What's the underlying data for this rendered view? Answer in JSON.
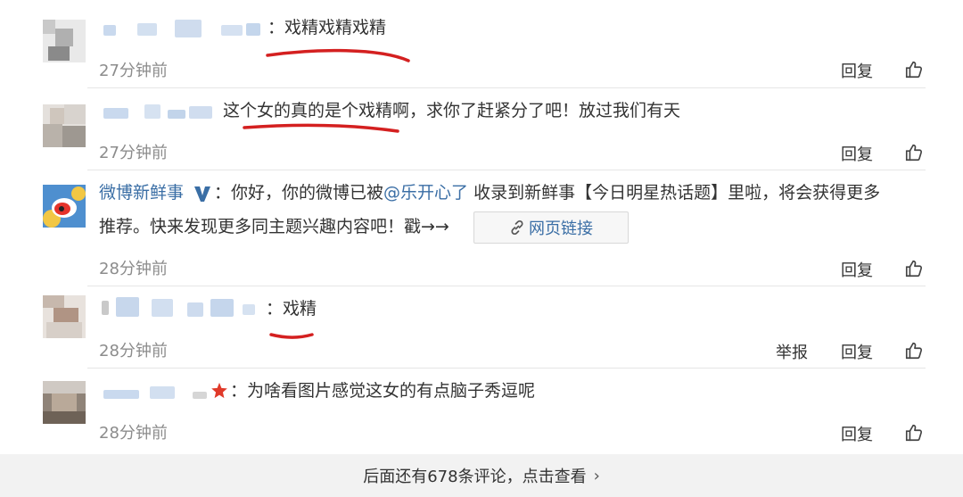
{
  "comments": [
    {
      "text": "戏精戏精戏精",
      "time": "27分钟前",
      "reply": "回复"
    },
    {
      "text": "这个女的真的是个戏精啊，求你了赶紧分了吧！放过我们有天",
      "time": "27分钟前",
      "reply": "回复"
    },
    {
      "user": "微博新鲜事",
      "text_line1_prefix": "：你好，你的微博已被",
      "mention": "@乐开心了",
      "text_line1_suffix": "收录到新鲜事【今日明星热话题】里啦，将会获得更多",
      "text_line2": "推荐。快来发现更多同主题兴趣内容吧！戳→→",
      "link_label": "网页链接",
      "time": "28分钟前",
      "reply": "回复"
    },
    {
      "text": "戏精",
      "time": "28分钟前",
      "report": "举报",
      "reply": "回复"
    },
    {
      "text": "为啥看图片感觉这女的有点脑子秀逗呢",
      "time": "28分钟前",
      "reply": "回复"
    }
  ],
  "footer": {
    "text": "后面还有678条评论，点击查看"
  },
  "colors": {
    "underline": "#d42020",
    "link": "#3a6ea5",
    "verified": "#3a6ea5",
    "star": "#e03a2a"
  }
}
